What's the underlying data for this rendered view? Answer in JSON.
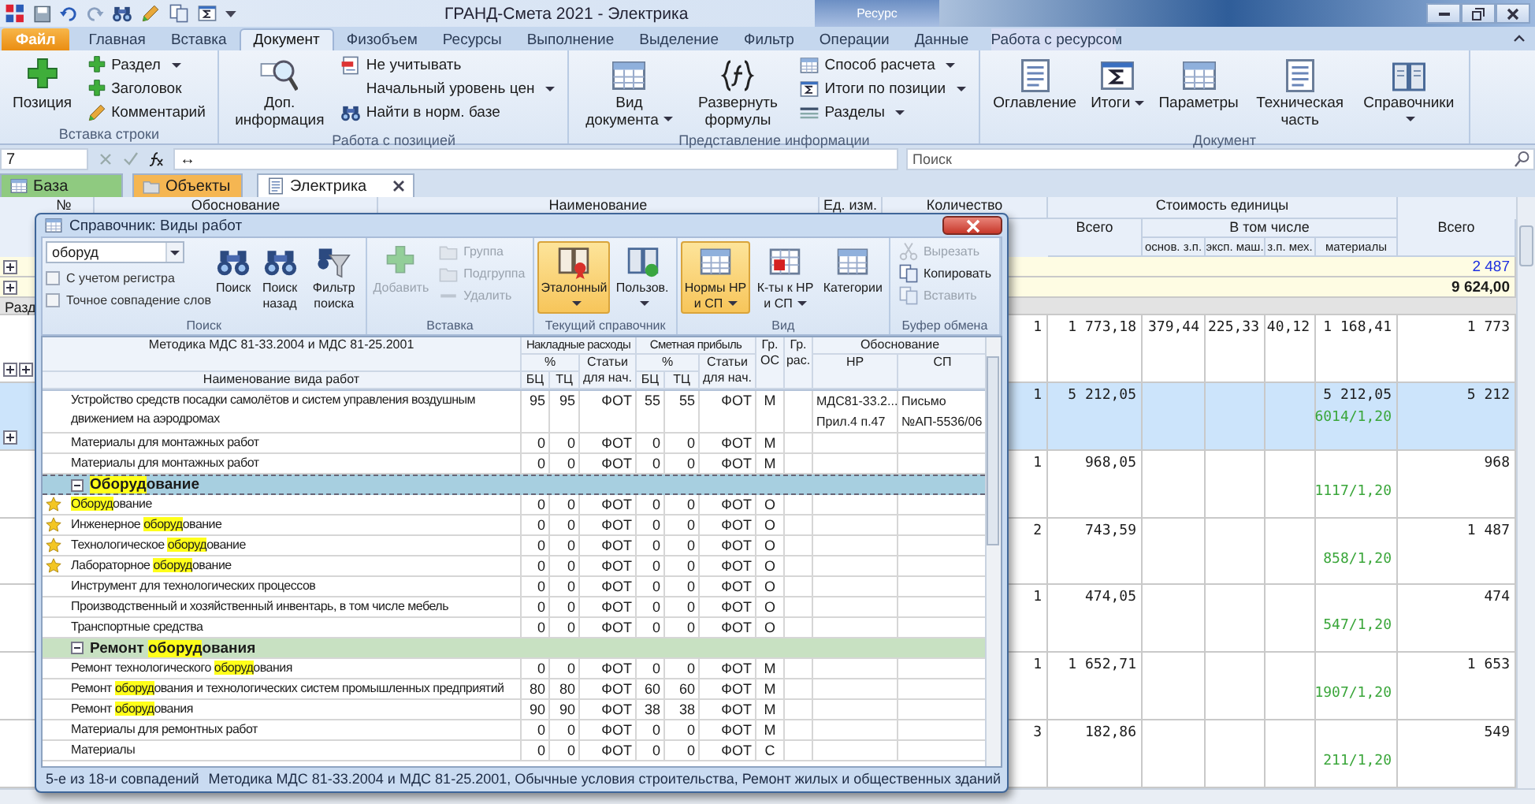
{
  "titlebar": {
    "title": "ГРАНД-Смета 2021 - Электрика",
    "context_group": "Ресурс"
  },
  "tabs": [
    {
      "label": "Файл",
      "kind": "file",
      "selected": false
    },
    {
      "label": "Главная",
      "kind": "normal",
      "selected": false
    },
    {
      "label": "Вставка",
      "kind": "normal",
      "selected": false
    },
    {
      "label": "Документ",
      "kind": "normal",
      "selected": true
    },
    {
      "label": "Физобъем",
      "kind": "normal",
      "selected": false
    },
    {
      "label": "Ресурсы",
      "kind": "normal",
      "selected": false
    },
    {
      "label": "Выполнение",
      "kind": "normal",
      "selected": false
    },
    {
      "label": "Выделение",
      "kind": "normal",
      "selected": false
    },
    {
      "label": "Фильтр",
      "kind": "normal",
      "selected": false
    },
    {
      "label": "Операции",
      "kind": "normal",
      "selected": false
    },
    {
      "label": "Данные",
      "kind": "normal",
      "selected": false
    },
    {
      "label": "Работа с ресурсом",
      "kind": "context",
      "selected": false
    }
  ],
  "ribbon": {
    "groups": [
      {
        "label": "Вставка строки",
        "items": [
          {
            "kind": "large",
            "label": "Позиция",
            "dropdown": false
          },
          {
            "kind": "small",
            "label": "Раздел",
            "dropdown": true
          },
          {
            "kind": "small",
            "label": "Заголовок",
            "dropdown": false
          },
          {
            "kind": "small",
            "label": "Комментарий",
            "dropdown": false
          }
        ]
      },
      {
        "label": "Работа с позицией",
        "items": [
          {
            "kind": "large",
            "label": "Доп. информация",
            "dropdown": false
          },
          {
            "kind": "small",
            "label": "Не учитывать",
            "dropdown": false
          },
          {
            "kind": "small",
            "label": "Начальный уровень цен",
            "dropdown": true
          },
          {
            "kind": "small",
            "label": "Найти в норм. базе",
            "dropdown": false
          }
        ]
      },
      {
        "label": "Представление информации",
        "items": [
          {
            "kind": "large",
            "label": "Вид документа",
            "dropdown": true
          },
          {
            "kind": "large",
            "label": "Развернуть формулы",
            "dropdown": false
          },
          {
            "kind": "small",
            "label": "Способ расчета",
            "dropdown": true
          },
          {
            "kind": "small",
            "label": "Итоги по позиции",
            "dropdown": true
          },
          {
            "kind": "small",
            "label": "Разделы",
            "dropdown": true
          }
        ]
      },
      {
        "label": "Документ",
        "items": [
          {
            "kind": "large",
            "label": "Оглавление",
            "dropdown": false
          },
          {
            "kind": "large",
            "label": "Итоги",
            "dropdown": true
          },
          {
            "kind": "large",
            "label": "Параметры",
            "dropdown": false
          },
          {
            "kind": "large",
            "label": "Техническая часть",
            "dropdown": false
          },
          {
            "kind": "large",
            "label": "Справочники",
            "dropdown": true
          }
        ]
      }
    ]
  },
  "formula_bar": {
    "cell": "7",
    "formula": "↔",
    "search": {
      "placeholder": "Поиск"
    }
  },
  "documents": [
    {
      "label": "База",
      "color": "#8fca80",
      "selected": false,
      "closable": false
    },
    {
      "label": "Объекты",
      "color": "#f5b652",
      "selected": false,
      "closable": false
    },
    {
      "label": "Электрика",
      "selected": true,
      "closable": true
    }
  ],
  "estimate": {
    "header": {
      "columns": [
        "№",
        "Обоснование",
        "Наименование",
        "Ед. изм.",
        "Количество"
      ],
      "unit_cost": "Стоимость единицы",
      "unit_total": "Всего",
      "including": "В том числе",
      "parts": [
        "основ. з.п.",
        "эксп. маш.",
        "з.п. мех.",
        "материалы"
      ],
      "total": "Всего"
    },
    "rows": [
      {
        "kind": "summary",
        "markers": [
          {
            "expanded": false
          }
        ],
        "link": true,
        "bold": false,
        "sum": "2 487"
      },
      {
        "kind": "summary",
        "markers": [
          {
            "expanded": false
          }
        ],
        "link": false,
        "bold": true,
        "sum": "9 624,00"
      },
      {
        "kind": "section",
        "label": "Разд"
      },
      {
        "kind": "item",
        "markers": [
          {
            "expanded": false
          },
          {
            "expanded": false
          }
        ],
        "selected": false,
        "qty": "1",
        "total": "1 773,18",
        "wage": "379,44",
        "machines": "225,33",
        "mech_wage": "40,12",
        "materials": "1 168,41",
        "sum": "1 773"
      },
      {
        "kind": "item",
        "markers": [
          {
            "expanded": false
          }
        ],
        "selected": true,
        "qty": "1",
        "total": "5 212,05",
        "materials": "5 212,05",
        "note": "6014/1,20",
        "sum": "5 212"
      },
      {
        "kind": "item",
        "selected": false,
        "qty": "1",
        "total": "968,05",
        "note": "1117/1,20",
        "sum": "968"
      },
      {
        "kind": "item",
        "selected": false,
        "qty": "2",
        "total": "743,59",
        "note": "858/1,20",
        "sum": "1 487"
      },
      {
        "kind": "item",
        "selected": false,
        "qty": "1",
        "total": "474,05",
        "note": "547/1,20",
        "sum": "474"
      },
      {
        "kind": "item",
        "selected": false,
        "qty": "1",
        "total": "1 652,71",
        "note": "1907/1,20",
        "sum": "1 653"
      },
      {
        "kind": "item",
        "selected": false,
        "qty": "3",
        "total": "182,86",
        "note": "211/1,20",
        "sum": "549"
      }
    ]
  },
  "dialog": {
    "title": "Справочник: Виды работ",
    "ribbon": {
      "groups": [
        {
          "label": "Поиск",
          "items": [
            {
              "kind": "combo",
              "value": "оборуд"
            },
            {
              "kind": "checkbox",
              "label": "С учетом регистра",
              "checked": false
            },
            {
              "kind": "checkbox",
              "label": "Точное совпадение слов",
              "checked": false
            },
            {
              "kind": "large",
              "label": "Поиск",
              "dropdown": false,
              "pressed": false,
              "disabled": false
            },
            {
              "kind": "large",
              "label": "Поиск назад",
              "dropdown": false,
              "pressed": false,
              "disabled": false
            },
            {
              "kind": "large",
              "label": "Фильтр поиска",
              "dropdown": false,
              "pressed": false,
              "disabled": false
            }
          ]
        },
        {
          "label": "Вставка",
          "items": [
            {
              "kind": "large",
              "label": "Добавить",
              "dropdown": false,
              "pressed": false,
              "disabled": true
            },
            {
              "kind": "small",
              "label": "Группа",
              "dropdown": false,
              "pressed": false,
              "disabled": true
            },
            {
              "kind": "small",
              "label": "Подгруппа",
              "dropdown": false,
              "pressed": false,
              "disabled": true
            },
            {
              "kind": "small",
              "label": "Удалить",
              "dropdown": false,
              "pressed": false,
              "disabled": true
            }
          ]
        },
        {
          "label": "Текущий справочник",
          "items": [
            {
              "kind": "large",
              "label": "Эталонный",
              "dropdown": true,
              "pressed": true,
              "disabled": false
            },
            {
              "kind": "large",
              "label": "Пользов.",
              "dropdown": true,
              "pressed": false,
              "disabled": false
            }
          ]
        },
        {
          "label": "Вид",
          "items": [
            {
              "kind": "large",
              "label": "Нормы НР и СП",
              "dropdown": true,
              "pressed": true,
              "disabled": false
            },
            {
              "kind": "large",
              "label": "К-ты к НР и СП",
              "dropdown": true,
              "pressed": false,
              "disabled": false
            },
            {
              "kind": "large",
              "label": "Категории",
              "dropdown": false,
              "pressed": false,
              "disabled": false
            }
          ]
        },
        {
          "label": "Буфер обмена",
          "items": [
            {
              "kind": "small",
              "label": "Вырезать",
              "dropdown": false,
              "pressed": false,
              "disabled": true
            },
            {
              "kind": "small",
              "label": "Копировать",
              "dropdown": false,
              "pressed": false,
              "disabled": false
            },
            {
              "kind": "small",
              "label": "Вставить",
              "dropdown": false,
              "pressed": false,
              "disabled": true
            }
          ]
        }
      ]
    },
    "table": {
      "header": {
        "method": "Методика МДС 81-33.2004 и МДС 81-25.2001",
        "name": "Наименование вида работ",
        "overhead": "Накладные расходы",
        "profit": "Сметная прибыль",
        "nr_percent": "%",
        "sp_percent": "%",
        "nr_base": "Статьи для нач.",
        "sp_base": "Статьи для нач.",
        "nr_bc": "БЦ",
        "nr_tc": "ТЦ",
        "sp_bc": "БЦ",
        "sp_tc": "ТЦ",
        "group_os": "Гр. ОС",
        "group_ras": "Гр. рас.",
        "basis": "Обоснование",
        "basis_nr": "НР",
        "basis_sp": "СП"
      },
      "rows": [
        {
          "kind": "item",
          "starred": false,
          "selected": false,
          "name": [
            {
              "text": "Устройство средств посадки самолётов и систем управления воздушным движением на аэродромах"
            }
          ],
          "nr_bc": "95",
          "nr_tc": "95",
          "nr_base": "ФОТ",
          "sp_bc": "55",
          "sp_tc": "55",
          "sp_base": "ФОТ",
          "os": "М",
          "nr_ref": "МДС81-33.2...\nПрил.4 п.47",
          "sp_ref": "Письмо\n№АП-5536/06"
        },
        {
          "kind": "item",
          "starred": false,
          "selected": false,
          "name": [
            {
              "text": "Материалы для монтажных работ"
            }
          ],
          "nr_bc": "0",
          "nr_tc": "0",
          "nr_base": "ФОТ",
          "sp_bc": "0",
          "sp_tc": "0",
          "sp_base": "ФОТ",
          "os": "М"
        },
        {
          "kind": "item",
          "starred": false,
          "selected": false,
          "name": [
            {
              "text": "Материалы для монтажных работ"
            }
          ],
          "nr_bc": "0",
          "nr_tc": "0",
          "nr_base": "ФОТ",
          "sp_bc": "0",
          "sp_tc": "0",
          "sp_base": "ФОТ",
          "os": "М"
        },
        {
          "kind": "group",
          "expanded": true,
          "selected": true,
          "name": [
            {
              "text": "Оборуд",
              "match": true
            },
            {
              "text": "ование"
            }
          ]
        },
        {
          "kind": "item",
          "starred": true,
          "selected": false,
          "name": [
            {
              "text": "Оборуд",
              "match": true
            },
            {
              "text": "ование"
            }
          ],
          "nr_bc": "0",
          "nr_tc": "0",
          "nr_base": "ФОТ",
          "sp_bc": "0",
          "sp_tc": "0",
          "sp_base": "ФОТ",
          "os": "О"
        },
        {
          "kind": "item",
          "starred": true,
          "selected": false,
          "name": [
            {
              "text": "Инженерное "
            },
            {
              "text": "оборуд",
              "match": true
            },
            {
              "text": "ование"
            }
          ],
          "nr_bc": "0",
          "nr_tc": "0",
          "nr_base": "ФОТ",
          "sp_bc": "0",
          "sp_tc": "0",
          "sp_base": "ФОТ",
          "os": "О"
        },
        {
          "kind": "item",
          "starred": true,
          "selected": false,
          "name": [
            {
              "text": "Технологическое "
            },
            {
              "text": "оборуд",
              "match": true
            },
            {
              "text": "ование"
            }
          ],
          "nr_bc": "0",
          "nr_tc": "0",
          "nr_base": "ФОТ",
          "sp_bc": "0",
          "sp_tc": "0",
          "sp_base": "ФОТ",
          "os": "О"
        },
        {
          "kind": "item",
          "starred": true,
          "selected": false,
          "name": [
            {
              "text": "Лабораторное "
            },
            {
              "text": "оборуд",
              "match": true
            },
            {
              "text": "ование"
            }
          ],
          "nr_bc": "0",
          "nr_tc": "0",
          "nr_base": "ФОТ",
          "sp_bc": "0",
          "sp_tc": "0",
          "sp_base": "ФОТ",
          "os": "О"
        },
        {
          "kind": "item",
          "starred": false,
          "selected": false,
          "name": [
            {
              "text": "Инструмент для технологических процессов"
            }
          ],
          "nr_bc": "0",
          "nr_tc": "0",
          "nr_base": "ФОТ",
          "sp_bc": "0",
          "sp_tc": "0",
          "sp_base": "ФОТ",
          "os": "О"
        },
        {
          "kind": "item",
          "starred": false,
          "selected": false,
          "name": [
            {
              "text": "Производственный и хозяйственный инвентарь, в том числе мебель"
            }
          ],
          "nr_bc": "0",
          "nr_tc": "0",
          "nr_base": "ФОТ",
          "sp_bc": "0",
          "sp_tc": "0",
          "sp_base": "ФОТ",
          "os": "О"
        },
        {
          "kind": "item",
          "starred": false,
          "selected": false,
          "name": [
            {
              "text": "Транспортные средства"
            }
          ],
          "nr_bc": "0",
          "nr_tc": "0",
          "nr_base": "ФОТ",
          "sp_bc": "0",
          "sp_tc": "0",
          "sp_base": "ФОТ",
          "os": "О"
        },
        {
          "kind": "group",
          "expanded": true,
          "selected": false,
          "name": [
            {
              "text": "Ремонт "
            },
            {
              "text": "оборуд",
              "match": true
            },
            {
              "text": "ования"
            }
          ]
        },
        {
          "kind": "item",
          "starred": false,
          "selected": false,
          "name": [
            {
              "text": "Ремонт технологического "
            },
            {
              "text": "оборуд",
              "match": true
            },
            {
              "text": "ования"
            }
          ],
          "nr_bc": "0",
          "nr_tc": "0",
          "nr_base": "ФОТ",
          "sp_bc": "0",
          "sp_tc": "0",
          "sp_base": "ФОТ",
          "os": "М"
        },
        {
          "kind": "item",
          "starred": false,
          "selected": false,
          "name": [
            {
              "text": "Ремонт "
            },
            {
              "text": "оборуд",
              "match": true
            },
            {
              "text": "ования и технологических систем промышленных предприятий"
            }
          ],
          "nr_bc": "80",
          "nr_tc": "80",
          "nr_base": "ФОТ",
          "sp_bc": "60",
          "sp_tc": "60",
          "sp_base": "ФОТ",
          "os": "М"
        },
        {
          "kind": "item",
          "starred": false,
          "selected": false,
          "name": [
            {
              "text": "Ремонт "
            },
            {
              "text": "оборуд",
              "match": true
            },
            {
              "text": "ования"
            }
          ],
          "nr_bc": "90",
          "nr_tc": "90",
          "nr_base": "ФОТ",
          "sp_bc": "38",
          "sp_tc": "38",
          "sp_base": "ФОТ",
          "os": "М"
        },
        {
          "kind": "item",
          "starred": false,
          "selected": false,
          "name": [
            {
              "text": "Материалы для ремонтных работ"
            }
          ],
          "nr_bc": "0",
          "nr_tc": "0",
          "nr_base": "ФОТ",
          "sp_bc": "0",
          "sp_tc": "0",
          "sp_base": "ФОТ",
          "os": "М"
        },
        {
          "kind": "item",
          "starred": false,
          "selected": false,
          "name": [
            {
              "text": "Материалы"
            }
          ],
          "nr_bc": "0",
          "nr_tc": "0",
          "nr_base": "ФОТ",
          "sp_bc": "0",
          "sp_tc": "0",
          "sp_base": "ФОТ",
          "os": "С"
        }
      ]
    },
    "status": [
      "5-е из 18-и совпадений",
      "Методика МДС 81-33.2004 и МДС 81-25.2001, Обычные условия строительства, Ремонт жилых и общественных зданий"
    ]
  }
}
